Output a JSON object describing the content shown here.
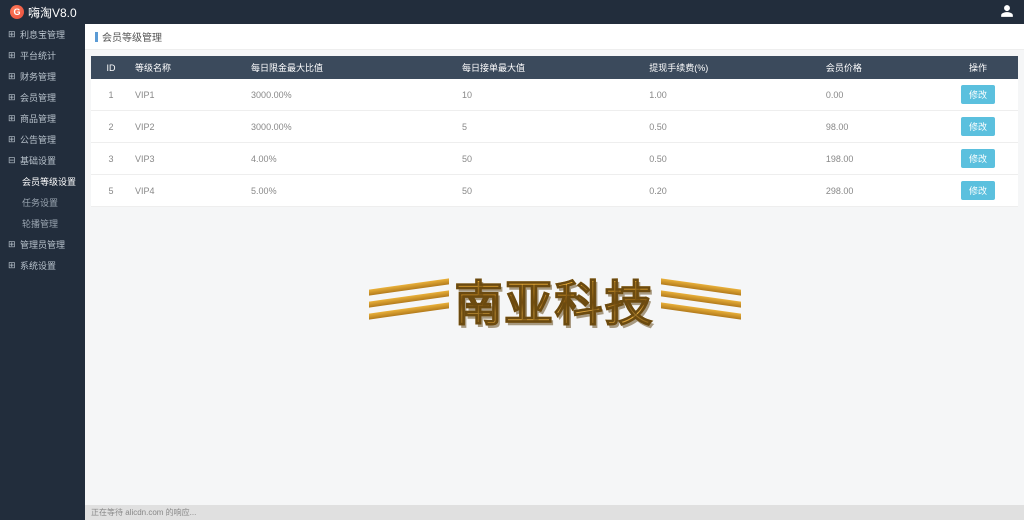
{
  "header": {
    "brand": "嗨淘V8.0"
  },
  "sidebar": {
    "items": [
      {
        "label": "利息宝管理"
      },
      {
        "label": "平台统计"
      },
      {
        "label": "财务管理"
      },
      {
        "label": "会员管理"
      },
      {
        "label": "商品管理"
      },
      {
        "label": "公告管理"
      },
      {
        "label": "基础设置"
      },
      {
        "label": "管理员管理"
      },
      {
        "label": "系统设置"
      }
    ],
    "subs": [
      {
        "label": "会员等级设置"
      },
      {
        "label": "任务设置"
      },
      {
        "label": "轮播管理"
      }
    ]
  },
  "crumb": {
    "title": "会员等级管理"
  },
  "table": {
    "headers": {
      "id": "ID",
      "name": "等级名称",
      "ratio": "每日限金最大比值",
      "max": "每日接单最大值",
      "fee": "提现手续费(%)",
      "price": "会员价格",
      "action": "操作"
    },
    "rows": [
      {
        "id": "1",
        "name": "VIP1",
        "ratio": "3000.00%",
        "max": "10",
        "fee": "1.00",
        "price": "0.00"
      },
      {
        "id": "2",
        "name": "VIP2",
        "ratio": "3000.00%",
        "max": "5",
        "fee": "0.50",
        "price": "98.00"
      },
      {
        "id": "3",
        "name": "VIP3",
        "ratio": "4.00%",
        "max": "50",
        "fee": "0.50",
        "price": "198.00"
      },
      {
        "id": "5",
        "name": "VIP4",
        "ratio": "5.00%",
        "max": "50",
        "fee": "0.20",
        "price": "298.00"
      }
    ],
    "edit_label": "修改"
  },
  "watermark": {
    "text": "南亚科技"
  },
  "status": {
    "text": "正在等待 alicdn.com 的响应..."
  }
}
